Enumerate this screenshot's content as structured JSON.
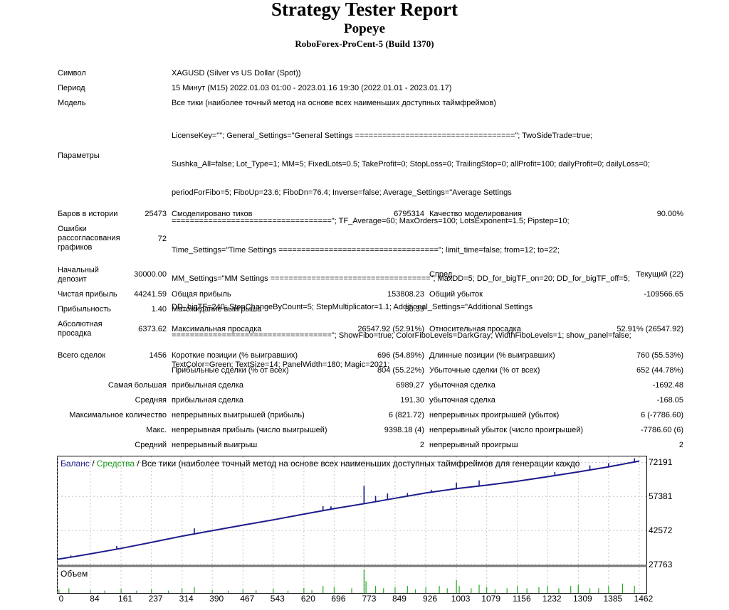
{
  "header": {
    "title": "Strategy Tester Report",
    "subtitle": "Popeye",
    "broker": "RoboForex-ProCent-5 (Build 1370)"
  },
  "info": {
    "symbol_label": "Символ",
    "symbol_value": "XAGUSD (Silver vs US Dollar (Spot))",
    "period_label": "Период",
    "period_value": "15 Минут (M15) 2022.01.03 01:00 - 2023.01.16 19:30 (2022.01.01 - 2023.01.17)",
    "model_label": "Модель",
    "model_value": "Все тики (наиболее точный метод на основе всех наименьших доступных таймфреймов)",
    "params_label": "Параметры",
    "params_lines": [
      "LicenseKey=\"\"; General_Settings=\"General Settings ===================================\"; TwoSideTrade=true;",
      "Sushka_All=false; Lot_Type=1; MM=5; FixedLots=0.5; TakeProfit=0; StopLoss=0; TrailingStop=0; allProfit=100; dailyProfit=0; dailyLoss=0;",
      "periodForFibo=5; FiboUp=23.6; FiboDn=76.4; Inverse=false; Average_Settings=\"Average Settings",
      "===================================\"; TF_Average=60; MaxOrders=100; LotsExponent=1.5; Pipstep=10;",
      "Time_Settings=\"Time Settings ===================================\"; limit_time=false; from=12; to=22;",
      "MM_Settings=\"MM Settings ===================================\"; MaxDD=5; DD_for_bigTF_on=20; DD_for_bigTF_off=5;",
      "DD_bigTF=240; StepChangeByCount=5; StepMultiplicator=1.1; Additional_Settings=\"Additional Settings",
      "===================================\"; ShowFibo=true; ColorFiboLevels=DarkGray; WidthFiboLevels=1; show_panel=false;",
      "TextColor=Green; TextSize=14; PanelWidth=180; Magic=2021;"
    ]
  },
  "stats": {
    "bars_label": "Баров в истории",
    "bars_value": "25473",
    "ticks_label": "Смоделировано тиков",
    "ticks_value": "6795314",
    "quality_label": "Качество моделирования",
    "quality_value": "90.00%",
    "errors_label": "Ошибки рассогласования графиков",
    "errors_value": "72",
    "deposit_label": "Начальный депозит",
    "deposit_value": "30000.00",
    "spread_label": "Спред",
    "spread_value": "Текущий (22)",
    "net_label": "Чистая прибыль",
    "net_value": "44241.59",
    "gross_profit_label": "Общая прибыль",
    "gross_profit_value": "153808.23",
    "gross_loss_label": "Общий убыток",
    "gross_loss_value": "-109566.65",
    "pf_label": "Прибыльность",
    "pf_value": "1.40",
    "expected_label": "Матожидание выигрыша",
    "expected_value": "30.39",
    "abs_dd_label": "Абсолютная просадка",
    "abs_dd_value": "6373.62",
    "max_dd_label": "Максимальная просадка",
    "max_dd_value": "26547.92 (52.91%)",
    "rel_dd_label": "Относительная просадка",
    "rel_dd_value": "52.91% (26547.92)",
    "total_label": "Всего сделок",
    "total_value": "1456",
    "short_label": "Короткие позиции (% выигравших)",
    "short_value": "696 (54.89%)",
    "long_label": "Длинные позиции (% выигравших)",
    "long_value": "760 (55.53%)",
    "profit_trades_label": "Прибыльные сделки (% от всех)",
    "profit_trades_value": "804 (55.22%)",
    "loss_trades_label": "Убыточные сделки (% от всех)",
    "loss_trades_value": "652 (44.78%)",
    "largest_label": "Самая большая",
    "largest_profit_label": "прибыльная сделка",
    "largest_profit_value": "6989.27",
    "largest_loss_label": "убыточная сделка",
    "largest_loss_value": "-1692.48",
    "average_label": "Средняя",
    "average_profit_label": "прибыльная сделка",
    "average_profit_value": "191.30",
    "average_loss_label": "убыточная сделка",
    "average_loss_value": "-168.05",
    "maxcount_label": "Максимальное количество",
    "maxcount_wins_label": "непрерывных выигрышей (прибыль)",
    "maxcount_wins_value": "6 (821.72)",
    "maxcount_losses_label": "непрерывных проигрышей (убыток)",
    "maxcount_losses_value": "6 (-7786.60)",
    "max_label": "Макс.",
    "max_profit_label": "непрерывная прибыль (число выигрышей)",
    "max_profit_value": "9398.18 (4)",
    "max_loss_label": "непрерывный убыток (число проигрышей)",
    "max_loss_value": "-7786.60 (6)",
    "avg_label": "Средний",
    "avg_win_label": "непрерывный выигрыш",
    "avg_win_value": "2",
    "avg_loss_label": "непрерывный проигрыш",
    "avg_loss_value": "2"
  },
  "chart_data": {
    "type": "line",
    "legend": {
      "balance": "Баланс",
      "sep": " / ",
      "equity": "Средства",
      "rest": " / Все тики (наиболее точный метод на основе всех наименьших доступных таймфреймов для генерации каждо"
    },
    "volume_label": "Объем",
    "colors": {
      "balance": "#1c1c8c",
      "equity": "#1a9a1a",
      "volume": "#22aa22",
      "grid": "#c8c8c8"
    },
    "x_ticks": [
      0,
      84,
      161,
      237,
      314,
      390,
      467,
      543,
      620,
      696,
      773,
      849,
      926,
      1003,
      1079,
      1156,
      1232,
      1309,
      1385,
      1462
    ],
    "y_ticks": [
      72191,
      57381,
      42572,
      27763
    ],
    "xlim": [
      0,
      1480
    ],
    "ylim": [
      27763,
      74500
    ],
    "balance_points": [
      [
        0,
        30000
      ],
      [
        40,
        31100
      ],
      [
        84,
        32400
      ],
      [
        161,
        34800
      ],
      [
        237,
        37400
      ],
      [
        314,
        40100
      ],
      [
        390,
        42500
      ],
      [
        467,
        44900
      ],
      [
        543,
        47200
      ],
      [
        620,
        49700
      ],
      [
        696,
        52100
      ],
      [
        773,
        54300
      ],
      [
        849,
        56600
      ],
      [
        926,
        58900
      ],
      [
        1003,
        60800
      ],
      [
        1079,
        62300
      ],
      [
        1156,
        64000
      ],
      [
        1232,
        66000
      ],
      [
        1309,
        68100
      ],
      [
        1385,
        70300
      ],
      [
        1462,
        72800
      ]
    ],
    "spikes": [
      [
        35,
        31700
      ],
      [
        150,
        35800
      ],
      [
        345,
        43500
      ],
      [
        668,
        53200
      ],
      [
        688,
        53100
      ],
      [
        740,
        53400
      ],
      [
        771,
        62000
      ],
      [
        800,
        57600
      ],
      [
        830,
        58700
      ],
      [
        880,
        58900
      ],
      [
        940,
        60300
      ],
      [
        1003,
        63400
      ],
      [
        1060,
        64400
      ],
      [
        1250,
        68000
      ],
      [
        1338,
        70900
      ],
      [
        1385,
        71900
      ],
      [
        1450,
        74000
      ]
    ],
    "volume_bars": [
      [
        5,
        0.15
      ],
      [
        30,
        0.2
      ],
      [
        84,
        0.12
      ],
      [
        120,
        0.1
      ],
      [
        161,
        0.18
      ],
      [
        200,
        0.1
      ],
      [
        237,
        0.15
      ],
      [
        280,
        0.1
      ],
      [
        314,
        0.2
      ],
      [
        345,
        0.25
      ],
      [
        390,
        0.12
      ],
      [
        430,
        0.1
      ],
      [
        467,
        0.15
      ],
      [
        500,
        0.12
      ],
      [
        543,
        0.18
      ],
      [
        580,
        0.1
      ],
      [
        620,
        0.22
      ],
      [
        640,
        0.12
      ],
      [
        668,
        0.3
      ],
      [
        696,
        0.25
      ],
      [
        740,
        0.2
      ],
      [
        771,
        1.0
      ],
      [
        776,
        0.5
      ],
      [
        800,
        0.3
      ],
      [
        820,
        0.2
      ],
      [
        849,
        0.25
      ],
      [
        880,
        0.3
      ],
      [
        900,
        0.15
      ],
      [
        926,
        0.25
      ],
      [
        960,
        0.3
      ],
      [
        980,
        0.2
      ],
      [
        1003,
        0.55
      ],
      [
        1010,
        0.3
      ],
      [
        1040,
        0.2
      ],
      [
        1060,
        0.35
      ],
      [
        1079,
        0.25
      ],
      [
        1100,
        0.15
      ],
      [
        1130,
        0.2
      ],
      [
        1156,
        0.3
      ],
      [
        1180,
        0.2
      ],
      [
        1210,
        0.25
      ],
      [
        1232,
        0.3
      ],
      [
        1260,
        0.2
      ],
      [
        1290,
        0.3
      ],
      [
        1309,
        0.35
      ],
      [
        1338,
        0.2
      ],
      [
        1360,
        0.2
      ],
      [
        1385,
        0.3
      ],
      [
        1420,
        0.4
      ],
      [
        1450,
        0.3
      ]
    ]
  }
}
